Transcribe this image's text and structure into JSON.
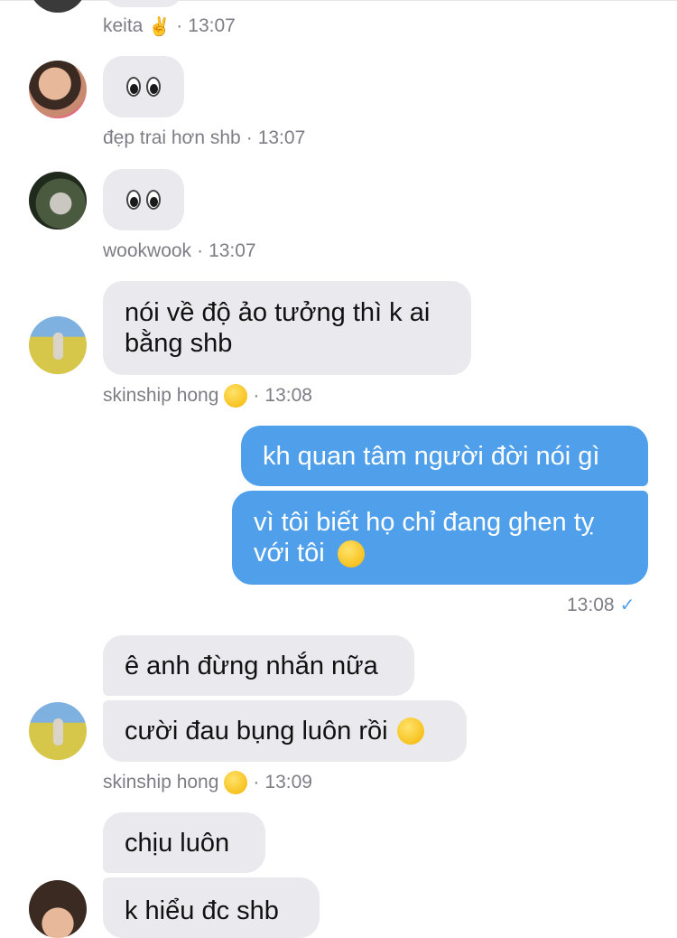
{
  "messages": [
    {
      "id": "m1",
      "sender": "keita",
      "time": "13:07",
      "sender_emoji": "✌️"
    },
    {
      "id": "m2",
      "sender": "đẹp trai hơn shb",
      "time": "13:07",
      "text": "👀"
    },
    {
      "id": "m3",
      "sender": "wookwook",
      "time": "13:07",
      "text": "👀"
    },
    {
      "id": "m4",
      "sender": "skinship hong",
      "sender_emoji": "🥰",
      "time": "13:08",
      "lines": [
        "nói về độ ảo tưởng thì k ai",
        "bằng shb"
      ]
    },
    {
      "id": "m5",
      "direction": "outgoing",
      "text": "kh quan tâm người đời nói gì"
    },
    {
      "id": "m6",
      "direction": "outgoing",
      "lines": [
        "vì tôi biết họ chỉ đang ghen tỵ",
        "với tôi"
      ],
      "emoji": "🤭",
      "time": "13:08",
      "status": "✓"
    },
    {
      "id": "m7",
      "sender": "skinship hong",
      "text": "ê anh đừng nhắn nữa"
    },
    {
      "id": "m8",
      "sender": "skinship hong",
      "sender_emoji": "🥰",
      "time": "13:09",
      "text": "cười đau bụng luôn rồi",
      "emoji": "🥲"
    },
    {
      "id": "m9",
      "text": "chịu luôn"
    },
    {
      "id": "m10",
      "text": "k hiểu đc shb"
    }
  ],
  "colors": {
    "incoming_bubble": "#e9e9ee",
    "outgoing_bubble": "#4f9fea",
    "meta_text": "#7d7d85",
    "check": "#4f9fea"
  },
  "icons": {
    "read_status": "check-icon"
  }
}
